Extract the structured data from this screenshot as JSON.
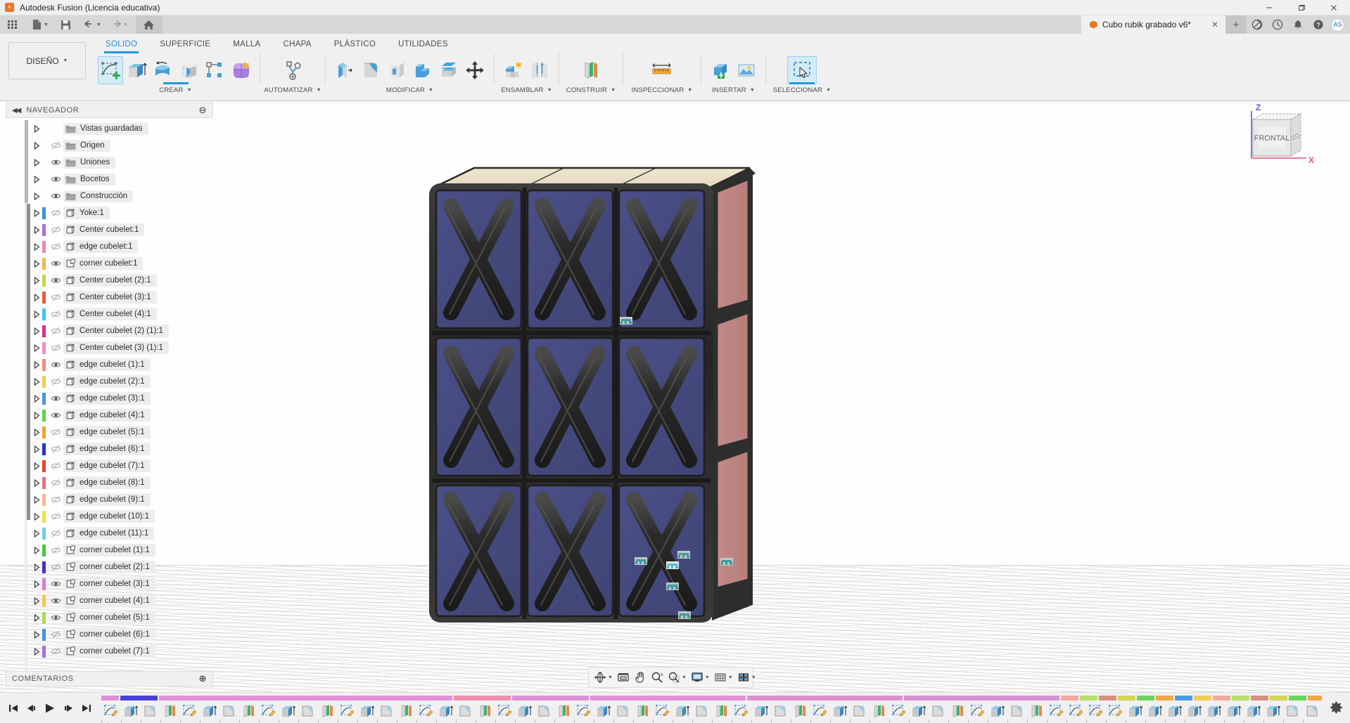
{
  "titlebar": {
    "app_title": "Autodesk Fusion (Licencia educativa)",
    "logo_text": "F",
    "minimize": "—",
    "maximize": "❐",
    "close": "✕"
  },
  "quick_access": {
    "grid_icon": "app-grid-icon",
    "new_icon": "new-document-icon",
    "save_icon": "save-icon",
    "undo_icon": "undo-icon",
    "redo_icon": "redo-icon",
    "home_icon": "home-icon"
  },
  "document_tab": {
    "label": "Cubo rubik grabado v6*",
    "close": "✕",
    "add_tab": "+"
  },
  "account_bar": {
    "extensions_icon": "extensions-icon",
    "jobs_icon": "job-status-icon",
    "notifications_icon": "bell-icon",
    "help_icon": "help-icon",
    "avatar_initials": "AS"
  },
  "ribbon": {
    "workspace": "DISEÑO",
    "tabs": [
      {
        "label": "SOLIDO",
        "active": true
      },
      {
        "label": "SUPERFICIE",
        "active": false
      },
      {
        "label": "MALLA",
        "active": false
      },
      {
        "label": "CHAPA",
        "active": false
      },
      {
        "label": "PLÁSTICO",
        "active": false
      },
      {
        "label": "UTILIDADES",
        "active": false
      }
    ],
    "groups": [
      {
        "label": "CREAR",
        "selected": true,
        "icons": [
          "create-sketch-icon",
          "extrude-icon",
          "revolve-icon",
          "sweep-icon",
          "pattern-icon",
          "form-icon"
        ]
      },
      {
        "label": "AUTOMATIZAR",
        "selected": false,
        "icons": [
          "automate-sheetmetal-icon"
        ]
      },
      {
        "label": "MODIFICAR",
        "selected": false,
        "icons": [
          "press-pull-icon",
          "fillet-icon",
          "shell-icon",
          "combine-icon",
          "offset-face-icon",
          "move-copy-icon"
        ]
      },
      {
        "label": "ENSAMBLAR",
        "selected": false,
        "icons": [
          "new-component-icon",
          "joint-icon"
        ]
      },
      {
        "label": "CONSTRUIR",
        "selected": false,
        "icons": [
          "offset-plane-icon"
        ]
      },
      {
        "label": "INSPECCIONAR",
        "selected": false,
        "icons": [
          "measure-icon"
        ]
      },
      {
        "label": "INSERTAR",
        "selected": false,
        "icons": [
          "insert-derive-icon",
          "insert-canvas-icon"
        ]
      },
      {
        "label": "SELECCIONAR",
        "selected": true,
        "icons": [
          "selection-filter-icon"
        ]
      }
    ]
  },
  "navigator": {
    "title": "NAVEGADOR",
    "collapse_icon": "collapse-left-icon",
    "minimize_icon": "minimize-panel-icon",
    "items": [
      {
        "label": "Vistas guardadas",
        "type": "folder",
        "eye": "none",
        "color": null
      },
      {
        "label": "Origen",
        "type": "folder",
        "eye": "hidden",
        "color": null
      },
      {
        "label": "Uniones",
        "type": "folder",
        "eye": "shown",
        "color": null
      },
      {
        "label": "Bocetos",
        "type": "folder",
        "eye": "shown",
        "color": null
      },
      {
        "label": "Construcción",
        "type": "folder",
        "eye": "shown",
        "color": null
      },
      {
        "label": "Yoke:1",
        "type": "comp",
        "eye": "hidden",
        "color": "#3f8fe0"
      },
      {
        "label": "Center cubelet:1",
        "type": "comp",
        "eye": "hidden",
        "color": "#a96fd8"
      },
      {
        "label": "edge cubelet:1",
        "type": "comp",
        "eye": "hidden",
        "color": "#ef85b5"
      },
      {
        "label": "corner cubelet:1",
        "type": "corner",
        "eye": "shown",
        "color": "#f7b35c"
      },
      {
        "label": "Center cubelet (2):1",
        "type": "comp",
        "eye": "shown",
        "color": "#c9d44a"
      },
      {
        "label": "Center cubelet (3):1",
        "type": "comp",
        "eye": "hidden",
        "color": "#ea5c3a"
      },
      {
        "label": "Center cubelet (4):1",
        "type": "comp",
        "eye": "hidden",
        "color": "#3ec8e8"
      },
      {
        "label": "Center cubelet (2) (1):1",
        "type": "comp",
        "eye": "hidden",
        "color": "#e8288f"
      },
      {
        "label": "Center cubelet (3) (1):1",
        "type": "comp",
        "eye": "hidden",
        "color": "#f48fc0"
      },
      {
        "label": "edge cubelet (1):1",
        "type": "comp",
        "eye": "shown",
        "color": "#ef8f7c"
      },
      {
        "label": "edge cubelet (2):1",
        "type": "comp",
        "eye": "hidden",
        "color": "#ecd24e"
      },
      {
        "label": "edge cubelet (3):1",
        "type": "comp",
        "eye": "shown",
        "color": "#4a92e0"
      },
      {
        "label": "edge cubelet (4):1",
        "type": "comp",
        "eye": "shown",
        "color": "#5ed44a"
      },
      {
        "label": "edge cubelet (5):1",
        "type": "comp",
        "eye": "hidden",
        "color": "#f0a032"
      },
      {
        "label": "edge cubelet (6):1",
        "type": "comp",
        "eye": "hidden",
        "color": "#2b32c8"
      },
      {
        "label": "edge cubelet (7):1",
        "type": "comp",
        "eye": "hidden",
        "color": "#e8442c"
      },
      {
        "label": "edge cubelet (8):1",
        "type": "comp",
        "eye": "hidden",
        "color": "#f06c80"
      },
      {
        "label": "edge cubelet (9):1",
        "type": "comp",
        "eye": "hidden",
        "color": "#f9b78f"
      },
      {
        "label": "edge cubelet (10):1",
        "type": "comp",
        "eye": "hidden",
        "color": "#f3dd4e"
      },
      {
        "label": "edge cubelet (11):1",
        "type": "comp",
        "eye": "hidden",
        "color": "#72cdf0"
      },
      {
        "label": "corner cubelet (1):1",
        "type": "corner",
        "eye": "hidden",
        "color": "#4ac83a"
      },
      {
        "label": "corner cubelet (2):1",
        "type": "corner",
        "eye": "hidden",
        "color": "#4a2bc8"
      },
      {
        "label": "corner cubelet (3):1",
        "type": "corner",
        "eye": "shown",
        "color": "#d87cd8"
      },
      {
        "label": "corner cubelet (4):1",
        "type": "corner",
        "eye": "shown",
        "color": "#f7c255"
      },
      {
        "label": "corner cubelet (5):1",
        "type": "corner",
        "eye": "shown",
        "color": "#a8dd52"
      },
      {
        "label": "corner cubelet (6):1",
        "type": "corner",
        "eye": "hidden",
        "color": "#4a8fe0"
      },
      {
        "label": "corner cubelet (7):1",
        "type": "corner",
        "eye": "hidden",
        "color": "#b06fd8"
      }
    ]
  },
  "comments": {
    "title": "COMENTARIOS",
    "add_icon": "add-comment-icon"
  },
  "viewcube": {
    "face_label": "FRONTAL",
    "side_label": "IZQ",
    "axis_z": "Z",
    "axis_x": "X",
    "axis_z_color": "#5b5bd6",
    "axis_x_color": "#e05b7a"
  },
  "model": {
    "name": "rubiks-cube-model",
    "front_face_color": "#454a7e",
    "right_face_color": "#c08380",
    "top_face_color": "#ece0c6",
    "frame_color": "#2e2e2e",
    "engraving": "X",
    "rows": 3,
    "cols": 3,
    "joint_markers": 7
  },
  "view_toolbar": {
    "items": [
      {
        "name": "orbit-icon",
        "caret": true
      },
      {
        "name": "view-grid-icon",
        "caret": false
      },
      {
        "name": "pan-icon",
        "caret": false
      },
      {
        "name": "zoom-icon",
        "caret": false
      },
      {
        "name": "zoom-window-icon",
        "caret": true
      },
      {
        "name": "display-mode-icon",
        "caret": true
      },
      {
        "name": "grid-snap-icon",
        "caret": true
      },
      {
        "name": "viewports-icon",
        "caret": true
      }
    ]
  },
  "timeline": {
    "playback": [
      {
        "name": "go-to-beginning-icon",
        "glyph": "◀|"
      },
      {
        "name": "step-back-icon",
        "glyph": "◀▮"
      },
      {
        "name": "play-icon",
        "glyph": "▶"
      },
      {
        "name": "step-forward-icon",
        "glyph": "▮▶"
      },
      {
        "name": "go-to-end-icon",
        "glyph": "|▶"
      }
    ],
    "settings_icon": "timeline-settings-icon",
    "group_bars": [
      {
        "color": "#de8fd8",
        "span": 1
      },
      {
        "color": "#4a3fd8",
        "span": 2
      },
      {
        "color": "#e58fd8",
        "span": 15
      },
      {
        "color": "#ef8fae",
        "span": 3
      },
      {
        "color": "#de8fd8",
        "span": 4
      },
      {
        "color": "#e58fd8",
        "span": 8
      },
      {
        "color": "#e08fd0",
        "span": 8
      },
      {
        "color": "#d98fd4",
        "span": 8
      },
      {
        "color": "#f4a8a0",
        "span": 1
      },
      {
        "color": "#b6e06a",
        "span": 1
      },
      {
        "color": "#d98f80",
        "span": 1
      },
      {
        "color": "#d4d455",
        "span": 1
      },
      {
        "color": "#6cd45c",
        "span": 1
      },
      {
        "color": "#f0a84a",
        "span": 1
      },
      {
        "color": "#4a9ae8",
        "span": 1
      },
      {
        "color": "#f0cc5c",
        "span": 1
      },
      {
        "color": "#f4a8a0",
        "span": 1
      },
      {
        "color": "#b6e06a",
        "span": 1
      },
      {
        "color": "#d98f80",
        "span": 1
      },
      {
        "color": "#d4d455",
        "span": 1
      },
      {
        "color": "#6cd45c",
        "span": 1
      },
      {
        "color": "#f0a84a",
        "span": 1
      },
      {
        "color": "#4a9ae8",
        "span": 1
      },
      {
        "color": "#f0cc5c",
        "span": 1
      }
    ],
    "feature_types": [
      "sketch",
      "extrude",
      "fillet",
      "appearance",
      "sketch",
      "extrude",
      "fillet",
      "appearance",
      "sketch",
      "extrude",
      "fillet",
      "appearance",
      "sketch",
      "extrude",
      "fillet",
      "appearance",
      "sketch",
      "extrude",
      "fillet",
      "appearance",
      "sketch",
      "extrude",
      "fillet",
      "appearance",
      "sketch",
      "extrude",
      "fillet",
      "appearance",
      "sketch",
      "extrude",
      "fillet",
      "appearance",
      "sketch",
      "extrude",
      "fillet",
      "appearance",
      "sketch",
      "extrude",
      "fillet",
      "appearance",
      "sketch",
      "extrude",
      "fillet",
      "appearance",
      "sketch",
      "extrude",
      "fillet",
      "appearance",
      "sketch",
      "sketch",
      "sketch",
      "sketch",
      "extrude",
      "extrude",
      "extrude",
      "extrude",
      "extrude",
      "extrude",
      "extrude",
      "extrude",
      "fillet",
      "fillet",
      "fillet",
      "fillet",
      "fillet",
      "fillet",
      "fillet",
      "fillet"
    ]
  }
}
